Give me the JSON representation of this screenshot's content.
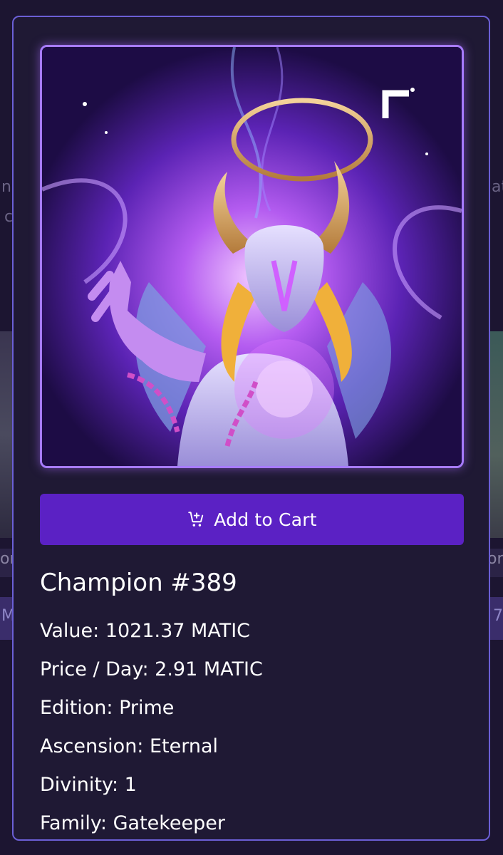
{
  "card": {
    "image_alt": "Champion artwork",
    "add_to_cart_label": "Add to Cart",
    "title": "Champion #389",
    "attributes": [
      {
        "text": "Value: 1021.37 MATIC"
      },
      {
        "text": "Price / Day: 2.91 MATIC"
      },
      {
        "text": "Edition: Prime"
      },
      {
        "text": "Ascension: Eternal"
      },
      {
        "text": "Divinity: 1"
      },
      {
        "text": "Family: Gatekeeper"
      }
    ]
  },
  "background": {
    "fragments": [
      "n",
      "c",
      "at",
      "or",
      "or",
      "M",
      "7"
    ]
  },
  "colors": {
    "page_bg": "#1c1531",
    "modal_bg": "#1f1934",
    "modal_border": "#6b5fd6",
    "button_bg": "#5b21c4",
    "art_border": "#a77bff"
  },
  "icons": {
    "cart": "add-to-cart-icon"
  }
}
